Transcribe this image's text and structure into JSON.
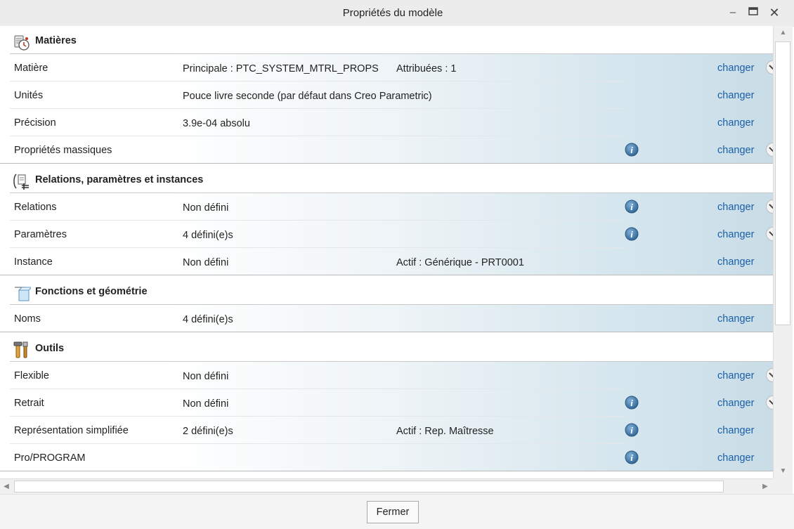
{
  "window": {
    "title": "Propriétés du modèle"
  },
  "sections": [
    {
      "title": "Matières",
      "icon": "materials-icon",
      "rows": [
        {
          "label": "Matière",
          "value": "Principale : PTC_SYSTEM_MTRL_PROPS",
          "extra": "Attribuées : 1",
          "info": false,
          "change": "changer",
          "expand": true
        },
        {
          "label": "Unités",
          "value": "Pouce livre seconde (par défaut dans Creo Parametric)",
          "extra": "",
          "info": false,
          "change": "changer",
          "expand": false
        },
        {
          "label": "Précision",
          "value": "3.9e-04 absolu",
          "extra": "",
          "info": false,
          "change": "changer",
          "expand": false
        },
        {
          "label": "Propriétés massiques",
          "value": "",
          "extra": "",
          "info": true,
          "change": "changer",
          "expand": true
        }
      ]
    },
    {
      "title": "Relations, paramètres et instances",
      "icon": "relations-icon",
      "rows": [
        {
          "label": "Relations",
          "value": "Non défini",
          "extra": "",
          "info": true,
          "change": "changer",
          "expand": true
        },
        {
          "label": "Paramètres",
          "value": "4 défini(e)s",
          "extra": "",
          "info": true,
          "change": "changer",
          "expand": true
        },
        {
          "label": "Instance",
          "value": "Non défini",
          "extra": "Actif : Générique - PRT0001",
          "info": false,
          "change": "changer",
          "expand": false
        }
      ]
    },
    {
      "title": "Fonctions et géométrie",
      "icon": "features-geometry-icon",
      "rows": [
        {
          "label": "Noms",
          "value": "4 défini(e)s",
          "extra": "",
          "info": false,
          "change": "changer",
          "expand": false
        }
      ]
    },
    {
      "title": "Outils",
      "icon": "tools-icon",
      "rows": [
        {
          "label": "Flexible",
          "value": "Non défini",
          "extra": "",
          "info": false,
          "change": "changer",
          "expand": true
        },
        {
          "label": "Retrait",
          "value": "Non défini",
          "extra": "",
          "info": true,
          "change": "changer",
          "expand": true
        },
        {
          "label": "Représentation simplifiée",
          "value": "2 défini(e)s",
          "extra": "Actif : Rep. Maîtresse",
          "info": true,
          "change": "changer",
          "expand": false
        },
        {
          "label": "Pro/PROGRAM",
          "value": "",
          "extra": "",
          "info": true,
          "change": "changer",
          "expand": false
        }
      ]
    }
  ],
  "footer": {
    "close_label": "Fermer"
  },
  "colors": {
    "link": "#1a5fa8",
    "info_icon": "#3e78a8",
    "row_gradient_end": "#c9dde7"
  }
}
